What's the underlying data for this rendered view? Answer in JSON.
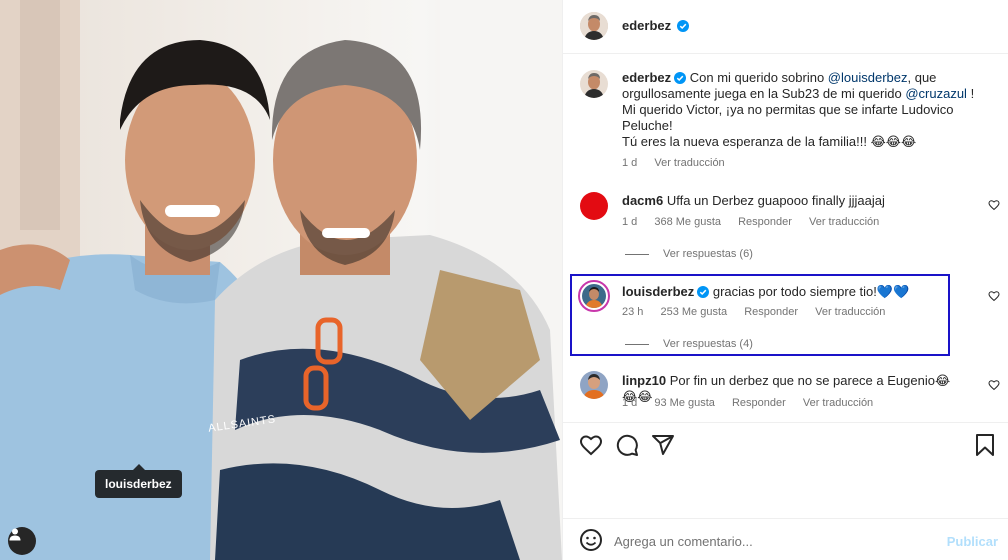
{
  "photo": {
    "tag_label": "louisderbez",
    "shirt_text": "ALLSAINTS"
  },
  "header": {
    "username": "ederbez"
  },
  "caption": {
    "username": "ederbez",
    "text_1": "Con mi querido sobrino",
    "mention_1": "@louisderbez",
    "text_2": ", que",
    "line_2": "orgullosamente juega en la Sub23 de mi querido",
    "mention_2": "@cruzazul",
    "text_3": "!",
    "line_3": "Mi querido Victor, ¡ya no permitas que se infarte Ludovico",
    "line_4": "Peluche!",
    "line_5": "Tú eres la nueva esperanza de la familia!!! 😂😂😂",
    "time": "1 d",
    "translate": "Ver traducción"
  },
  "comments": [
    {
      "username": "dacm6",
      "text": "Uffa un Derbez guapooo finally jjjaajaj",
      "time": "1 d",
      "likes": "368 Me gusta",
      "reply": "Responder",
      "translate": "Ver traducción",
      "view_replies": "Ver respuestas (6)"
    },
    {
      "username": "louisderbez",
      "text": "gracias por todo siempre tio!💙💙",
      "time": "23 h",
      "likes": "253 Me gusta",
      "reply": "Responder",
      "translate": "Ver traducción",
      "view_replies": "Ver respuestas (4)"
    },
    {
      "username": "linpz10",
      "text": "Por fin un derbez que no se parece a Eugenio😂😂😂",
      "time": "1 d",
      "likes": "93 Me gusta",
      "reply": "Responder",
      "translate": "Ver traducción"
    }
  ],
  "footer": {
    "comment_placeholder": "Agrega un comentario...",
    "publish_label": "Publicar"
  },
  "colors": {
    "highlight_border": "#1a13c8",
    "mention": "#00376b",
    "verified": "#0095f6",
    "publish_disabled": "#b2dffc"
  },
  "icons": [
    "verified-icon",
    "heart-icon",
    "comment-icon",
    "share-icon",
    "bookmark-icon",
    "emoji-icon",
    "person-tag-icon"
  ]
}
